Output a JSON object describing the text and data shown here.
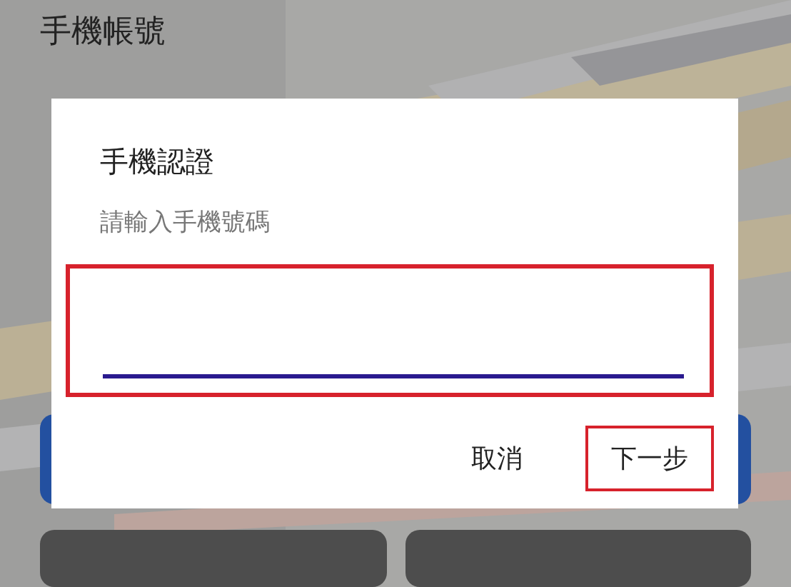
{
  "screen": {
    "title": "手機帳號"
  },
  "dialog": {
    "title": "手機認證",
    "prompt": "請輸入手機號碼",
    "input": {
      "highlighted": true
    },
    "buttons": [
      {
        "label": "取消",
        "highlighted": false
      },
      {
        "label": "下一步",
        "highlighted": true
      }
    ]
  }
}
